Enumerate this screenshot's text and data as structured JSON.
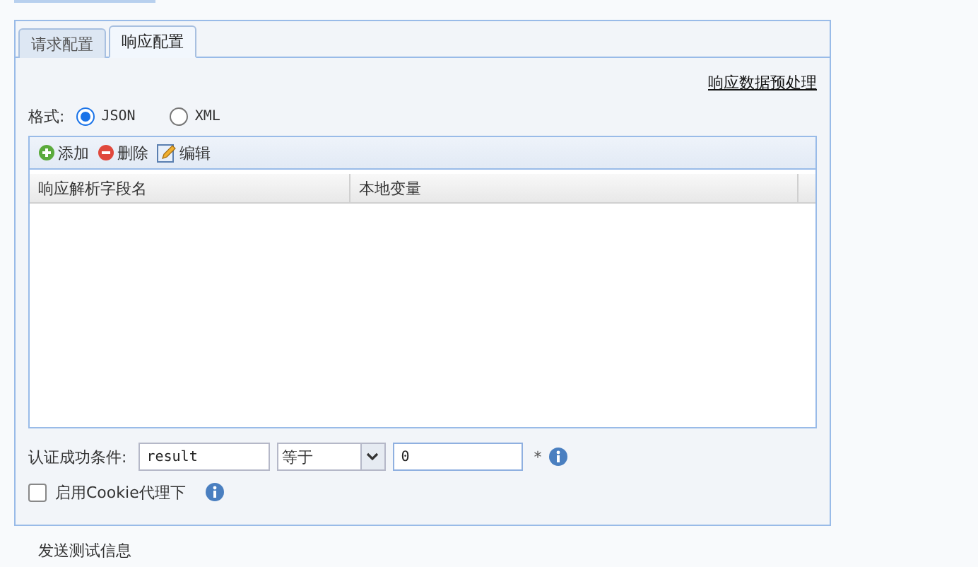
{
  "tabs": [
    {
      "label": "请求配置",
      "selected": false
    },
    {
      "label": "响应配置",
      "selected": true
    }
  ],
  "preprocess_link": "响应数据预处理",
  "format": {
    "label": "格式:",
    "options": [
      {
        "label": "JSON",
        "selected": true
      },
      {
        "label": "XML",
        "selected": false
      }
    ]
  },
  "grid": {
    "toolbar": [
      {
        "kind": "add",
        "label": "添加"
      },
      {
        "kind": "delete",
        "label": "删除"
      },
      {
        "kind": "edit",
        "label": "编辑"
      }
    ],
    "columns": [
      "响应解析字段名",
      "本地变量"
    ]
  },
  "condition": {
    "label": "认证成功条件:",
    "field": "result",
    "operator": "等于",
    "value": "0",
    "required_mark": "*"
  },
  "cookie_proxy": {
    "label": "启用Cookie代理下",
    "checked": false
  },
  "footer_link": "发送测试信息"
}
